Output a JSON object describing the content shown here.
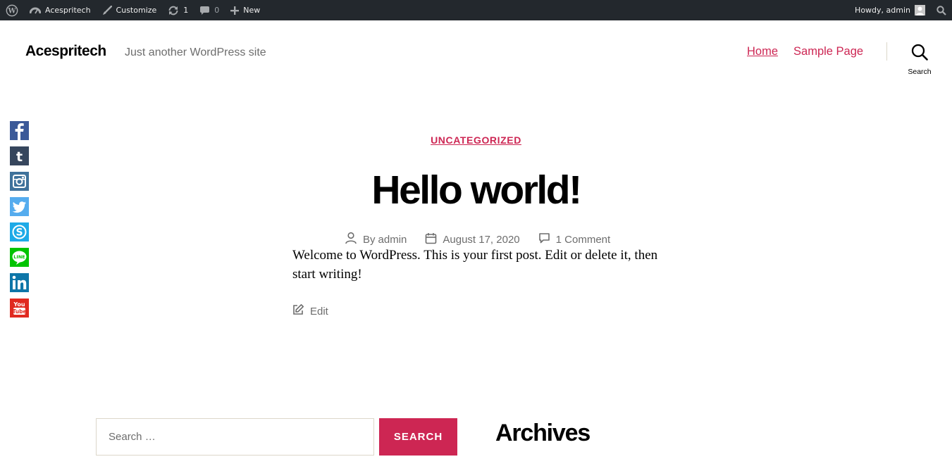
{
  "adminbar": {
    "site_name": "Acespritech",
    "customize": "Customize",
    "updates_count": "1",
    "comments_count": "0",
    "new_label": "New",
    "howdy": "Howdy, admin"
  },
  "header": {
    "site_title": "Acespritech",
    "site_description": "Just another WordPress site",
    "nav": [
      {
        "label": "Home"
      },
      {
        "label": "Sample Page"
      }
    ],
    "search_label": "Search"
  },
  "social": [
    {
      "name": "facebook",
      "color": "#3b5998"
    },
    {
      "name": "tumblr",
      "color": "#36465d"
    },
    {
      "name": "instagram",
      "color": "#3f729b"
    },
    {
      "name": "twitter",
      "color": "#55acee"
    },
    {
      "name": "skype",
      "color": "#1eaae7"
    },
    {
      "name": "line",
      "color": "#00c300"
    },
    {
      "name": "linkedin",
      "color": "#0e76a8"
    },
    {
      "name": "youtube",
      "color": "#e02a20"
    }
  ],
  "post": {
    "category": "UNCATEGORIZED",
    "title": "Hello world!",
    "author": "admin",
    "author_prefix": "By",
    "date": "August 17, 2020",
    "comments": "1 Comment",
    "content": "Welcome to WordPress. This is your first post. Edit or delete it, then start writing!",
    "edit_label": "Edit"
  },
  "widgets": {
    "search_placeholder": "Search …",
    "search_button": "SEARCH",
    "archives_title": "Archives"
  },
  "colors": {
    "accent": "#cd2653",
    "adminbar_bg": "#23282d",
    "meta_text": "#6d6d6d"
  }
}
